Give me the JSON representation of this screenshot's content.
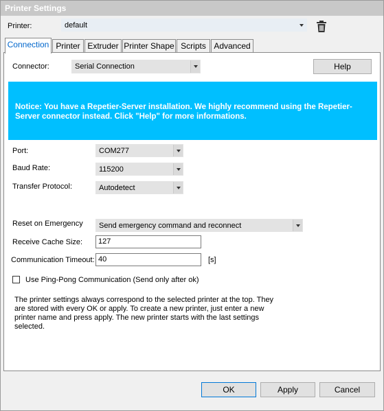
{
  "window": {
    "title": "Printer Settings"
  },
  "printer": {
    "label": "Printer:",
    "value": "default"
  },
  "tabs": [
    {
      "label": "Connection"
    },
    {
      "label": "Printer"
    },
    {
      "label": "Extruder"
    },
    {
      "label": "Printer Shape"
    },
    {
      "label": "Scripts"
    },
    {
      "label": "Advanced"
    }
  ],
  "connection": {
    "connector_label": "Connector:",
    "connector_value": "Serial Connection",
    "help_label": "Help",
    "notice": "Notice: You have a Repetier-Server installation. We highly recommend using the Repetier-Server connector instead. Click \"Help\" for more informations.",
    "port_label": "Port:",
    "port_value": "COM277",
    "baud_label": "Baud Rate:",
    "baud_value": "115200",
    "protocol_label": "Transfer Protocol:",
    "protocol_value": "Autodetect",
    "reset_label": "Reset on Emergency",
    "reset_value": "Send emergency command and reconnect",
    "cache_label": "Receive Cache Size:",
    "cache_value": "127",
    "timeout_label": "Communication Timeout:",
    "timeout_value": "40",
    "timeout_unit": "[s]",
    "pingpong_label": "Use Ping-Pong Communication (Send only after ok)",
    "pingpong_checked": false,
    "info_text": "The printer settings always correspond to the selected printer at the top. They are stored with every OK or apply. To create a new printer, just enter a new printer name and press apply. The new printer starts with the last settings selected."
  },
  "footer": {
    "ok_label": "OK",
    "apply_label": "Apply",
    "cancel_label": "Cancel"
  }
}
